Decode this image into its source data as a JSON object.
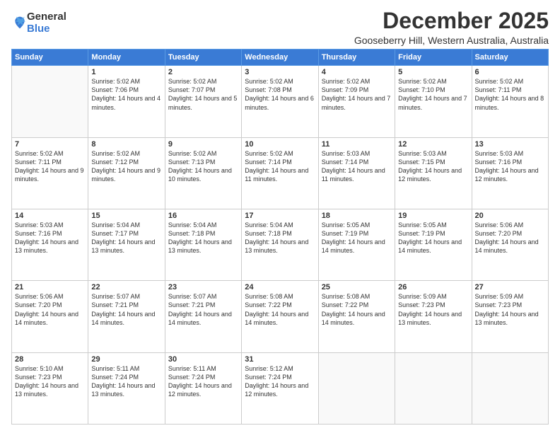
{
  "logo": {
    "general": "General",
    "blue": "Blue"
  },
  "header": {
    "month": "December 2025",
    "location": "Gooseberry Hill, Western Australia, Australia"
  },
  "days_of_week": [
    "Sunday",
    "Monday",
    "Tuesday",
    "Wednesday",
    "Thursday",
    "Friday",
    "Saturday"
  ],
  "weeks": [
    [
      {
        "day": "",
        "sunrise": "",
        "sunset": "",
        "daylight": ""
      },
      {
        "day": "1",
        "sunrise": "Sunrise: 5:02 AM",
        "sunset": "Sunset: 7:06 PM",
        "daylight": "Daylight: 14 hours and 4 minutes."
      },
      {
        "day": "2",
        "sunrise": "Sunrise: 5:02 AM",
        "sunset": "Sunset: 7:07 PM",
        "daylight": "Daylight: 14 hours and 5 minutes."
      },
      {
        "day": "3",
        "sunrise": "Sunrise: 5:02 AM",
        "sunset": "Sunset: 7:08 PM",
        "daylight": "Daylight: 14 hours and 6 minutes."
      },
      {
        "day": "4",
        "sunrise": "Sunrise: 5:02 AM",
        "sunset": "Sunset: 7:09 PM",
        "daylight": "Daylight: 14 hours and 7 minutes."
      },
      {
        "day": "5",
        "sunrise": "Sunrise: 5:02 AM",
        "sunset": "Sunset: 7:10 PM",
        "daylight": "Daylight: 14 hours and 7 minutes."
      },
      {
        "day": "6",
        "sunrise": "Sunrise: 5:02 AM",
        "sunset": "Sunset: 7:11 PM",
        "daylight": "Daylight: 14 hours and 8 minutes."
      }
    ],
    [
      {
        "day": "7",
        "sunrise": "Sunrise: 5:02 AM",
        "sunset": "Sunset: 7:11 PM",
        "daylight": "Daylight: 14 hours and 9 minutes."
      },
      {
        "day": "8",
        "sunrise": "Sunrise: 5:02 AM",
        "sunset": "Sunset: 7:12 PM",
        "daylight": "Daylight: 14 hours and 9 minutes."
      },
      {
        "day": "9",
        "sunrise": "Sunrise: 5:02 AM",
        "sunset": "Sunset: 7:13 PM",
        "daylight": "Daylight: 14 hours and 10 minutes."
      },
      {
        "day": "10",
        "sunrise": "Sunrise: 5:02 AM",
        "sunset": "Sunset: 7:14 PM",
        "daylight": "Daylight: 14 hours and 11 minutes."
      },
      {
        "day": "11",
        "sunrise": "Sunrise: 5:03 AM",
        "sunset": "Sunset: 7:14 PM",
        "daylight": "Daylight: 14 hours and 11 minutes."
      },
      {
        "day": "12",
        "sunrise": "Sunrise: 5:03 AM",
        "sunset": "Sunset: 7:15 PM",
        "daylight": "Daylight: 14 hours and 12 minutes."
      },
      {
        "day": "13",
        "sunrise": "Sunrise: 5:03 AM",
        "sunset": "Sunset: 7:16 PM",
        "daylight": "Daylight: 14 hours and 12 minutes."
      }
    ],
    [
      {
        "day": "14",
        "sunrise": "Sunrise: 5:03 AM",
        "sunset": "Sunset: 7:16 PM",
        "daylight": "Daylight: 14 hours and 13 minutes."
      },
      {
        "day": "15",
        "sunrise": "Sunrise: 5:04 AM",
        "sunset": "Sunset: 7:17 PM",
        "daylight": "Daylight: 14 hours and 13 minutes."
      },
      {
        "day": "16",
        "sunrise": "Sunrise: 5:04 AM",
        "sunset": "Sunset: 7:18 PM",
        "daylight": "Daylight: 14 hours and 13 minutes."
      },
      {
        "day": "17",
        "sunrise": "Sunrise: 5:04 AM",
        "sunset": "Sunset: 7:18 PM",
        "daylight": "Daylight: 14 hours and 13 minutes."
      },
      {
        "day": "18",
        "sunrise": "Sunrise: 5:05 AM",
        "sunset": "Sunset: 7:19 PM",
        "daylight": "Daylight: 14 hours and 14 minutes."
      },
      {
        "day": "19",
        "sunrise": "Sunrise: 5:05 AM",
        "sunset": "Sunset: 7:19 PM",
        "daylight": "Daylight: 14 hours and 14 minutes."
      },
      {
        "day": "20",
        "sunrise": "Sunrise: 5:06 AM",
        "sunset": "Sunset: 7:20 PM",
        "daylight": "Daylight: 14 hours and 14 minutes."
      }
    ],
    [
      {
        "day": "21",
        "sunrise": "Sunrise: 5:06 AM",
        "sunset": "Sunset: 7:20 PM",
        "daylight": "Daylight: 14 hours and 14 minutes."
      },
      {
        "day": "22",
        "sunrise": "Sunrise: 5:07 AM",
        "sunset": "Sunset: 7:21 PM",
        "daylight": "Daylight: 14 hours and 14 minutes."
      },
      {
        "day": "23",
        "sunrise": "Sunrise: 5:07 AM",
        "sunset": "Sunset: 7:21 PM",
        "daylight": "Daylight: 14 hours and 14 minutes."
      },
      {
        "day": "24",
        "sunrise": "Sunrise: 5:08 AM",
        "sunset": "Sunset: 7:22 PM",
        "daylight": "Daylight: 14 hours and 14 minutes."
      },
      {
        "day": "25",
        "sunrise": "Sunrise: 5:08 AM",
        "sunset": "Sunset: 7:22 PM",
        "daylight": "Daylight: 14 hours and 14 minutes."
      },
      {
        "day": "26",
        "sunrise": "Sunrise: 5:09 AM",
        "sunset": "Sunset: 7:23 PM",
        "daylight": "Daylight: 14 hours and 13 minutes."
      },
      {
        "day": "27",
        "sunrise": "Sunrise: 5:09 AM",
        "sunset": "Sunset: 7:23 PM",
        "daylight": "Daylight: 14 hours and 13 minutes."
      }
    ],
    [
      {
        "day": "28",
        "sunrise": "Sunrise: 5:10 AM",
        "sunset": "Sunset: 7:23 PM",
        "daylight": "Daylight: 14 hours and 13 minutes."
      },
      {
        "day": "29",
        "sunrise": "Sunrise: 5:11 AM",
        "sunset": "Sunset: 7:24 PM",
        "daylight": "Daylight: 14 hours and 13 minutes."
      },
      {
        "day": "30",
        "sunrise": "Sunrise: 5:11 AM",
        "sunset": "Sunset: 7:24 PM",
        "daylight": "Daylight: 14 hours and 12 minutes."
      },
      {
        "day": "31",
        "sunrise": "Sunrise: 5:12 AM",
        "sunset": "Sunset: 7:24 PM",
        "daylight": "Daylight: 14 hours and 12 minutes."
      },
      {
        "day": "",
        "sunrise": "",
        "sunset": "",
        "daylight": ""
      },
      {
        "day": "",
        "sunrise": "",
        "sunset": "",
        "daylight": ""
      },
      {
        "day": "",
        "sunrise": "",
        "sunset": "",
        "daylight": ""
      }
    ]
  ]
}
